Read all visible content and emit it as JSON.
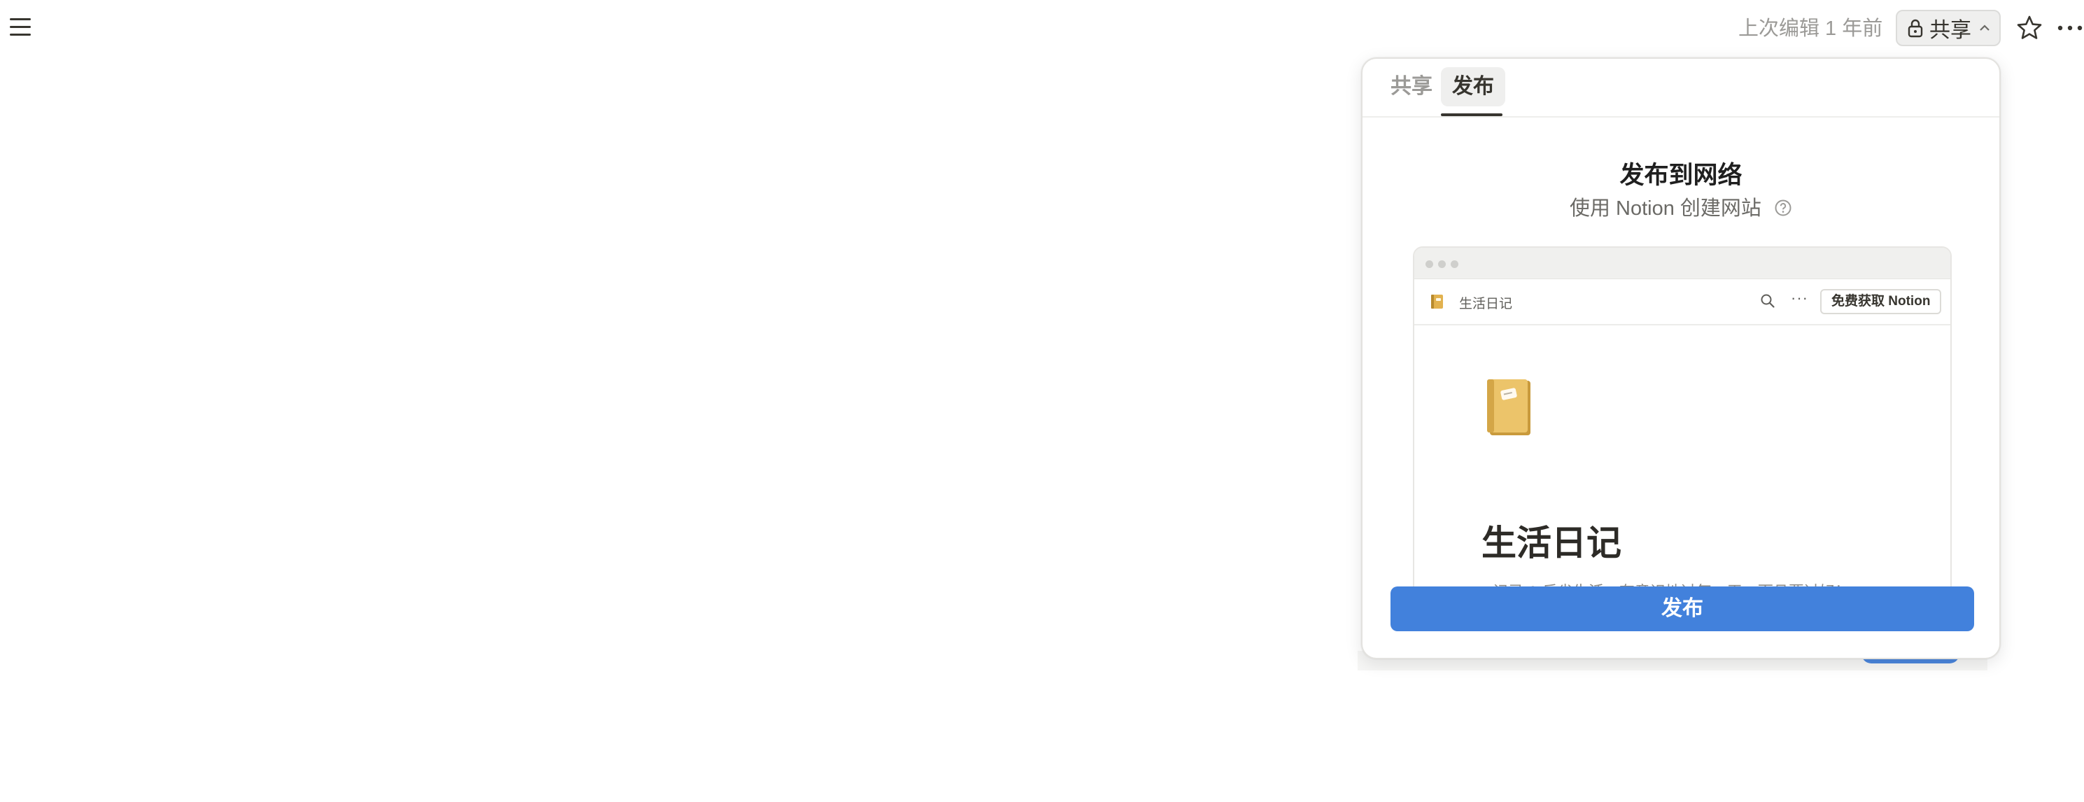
{
  "topbar": {
    "last_edited": "上次编辑 1 年前",
    "share_label": "共享",
    "icons": [
      "menu-icon",
      "lock-icon",
      "chevron-up-icon",
      "star-icon",
      "more-horizontal-icon"
    ]
  },
  "panel": {
    "tabs": [
      {
        "label": "共享",
        "selected": false
      },
      {
        "label": "发布",
        "selected": true
      }
    ],
    "title": "发布到网络",
    "subtitle": "使用 Notion 创建网站",
    "preview": {
      "nav_title": "生活日记",
      "get_notion_label": "免费获取 Notion",
      "more_label": "···",
      "page_title": "生活日记",
      "description": "记录 & 反省生活，有意识地过每一天，而且要过好！",
      "icons": [
        "notebook-icon",
        "search-icon",
        "more-horizontal-icon"
      ]
    },
    "publish_label": "发布"
  },
  "colors": {
    "accent": "#4281dc",
    "text": "#37352f",
    "muted": "#9b9a97",
    "tab_selected_bg": "#efefee"
  }
}
